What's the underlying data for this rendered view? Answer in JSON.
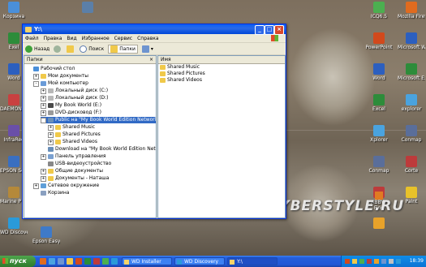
{
  "desktop": {
    "left_icons": [
      {
        "label": "Корзина",
        "color": "#4a8fd9"
      },
      {
        "label": "Exel",
        "color": "#2d8c3a"
      },
      {
        "label": "Word",
        "color": "#2c5fbf"
      },
      {
        "label": "DAEMON Tools L",
        "color": "#c94040"
      },
      {
        "label": "InfraRec",
        "color": "#6a4fa8"
      },
      {
        "label": "EPSON Scan",
        "color": "#3a6fc0"
      },
      {
        "label": "Marine P Empire",
        "color": "#b5893a"
      },
      {
        "label": "WD Discovery",
        "color": "#2a9ad9"
      }
    ],
    "col2_icons": [
      {
        "label": "",
        "color": "#d9d3c2"
      },
      {
        "label": "Epson Easy Photo Print",
        "color": "#3f7ac8"
      }
    ],
    "right_icons": [
      {
        "label": "ICQ6.5",
        "color": "#4caf50"
      },
      {
        "label": "PowerPoint",
        "color": "#d2491c"
      },
      {
        "label": "Word",
        "color": "#2c5fbf"
      },
      {
        "label": "Excel",
        "color": "#2d8c3a"
      },
      {
        "label": "Xplorer",
        "color": "#4aa3df"
      },
      {
        "label": "Conmap",
        "color": "#5a6e9a"
      },
      {
        "label": "",
        "color": "#bd3b3b"
      },
      {
        "label": "",
        "color": "#e8a22a"
      }
    ],
    "right2_icons": [
      {
        "label": "Mozilla Firefox",
        "color": "#e06b1f"
      },
      {
        "label": "Microsoft Word",
        "color": "#2c5fbf"
      },
      {
        "label": "Microsoft Excel",
        "color": "#2d8c3a"
      },
      {
        "label": "explorer",
        "color": "#4aa3df"
      },
      {
        "label": "Conmap",
        "color": "#5a6e9a"
      },
      {
        "label": "Corte",
        "color": "#bd3b3b"
      },
      {
        "label": "Paint",
        "color": "#e8c22a"
      }
    ],
    "watermark": "GYBERSTYLE.RU",
    "midright_labels": [
      "ABBYY",
      "Fine"
    ]
  },
  "window": {
    "title": "Y:\\",
    "menu": [
      "Файл",
      "Правка",
      "Вид",
      "Избранное",
      "Сервис",
      "Справка"
    ],
    "toolbar": {
      "back": "Назад",
      "search": "Поиск",
      "folders": "Папки"
    },
    "left_pane_title": "Папки",
    "tree": [
      {
        "label": "Рабочий стол",
        "depth": 0,
        "exp": "",
        "color": "#4a8fd9"
      },
      {
        "label": "Мои документы",
        "depth": 1,
        "exp": "+",
        "color": "#f0c94a"
      },
      {
        "label": "Мой компьютер",
        "depth": 1,
        "exp": "-",
        "color": "#6a9bd8"
      },
      {
        "label": "Локальный диск (C:)",
        "depth": 2,
        "exp": "+",
        "color": "#b8b8b8"
      },
      {
        "label": "Локальный диск (D:)",
        "depth": 2,
        "exp": "+",
        "color": "#b8b8b8"
      },
      {
        "label": "My Book World (E:)",
        "depth": 2,
        "exp": "+",
        "color": "#4a4a4a"
      },
      {
        "label": "DVD-дисковод (F:)",
        "depth": 2,
        "exp": "+",
        "color": "#9a9a9a"
      },
      {
        "label": "Public на \"My Book World Edition Network Stor",
        "depth": 2,
        "exp": "-",
        "color": "#6a8fb8",
        "selected": true
      },
      {
        "label": "Shared Music",
        "depth": 3,
        "exp": "+",
        "color": "#f0c94a"
      },
      {
        "label": "Shared Pictures",
        "depth": 3,
        "exp": "+",
        "color": "#f0c94a"
      },
      {
        "label": "Shared Videos",
        "depth": 3,
        "exp": "+",
        "color": "#f0c94a"
      },
      {
        "label": "Download на \"My Book World Edition Network",
        "depth": 2,
        "exp": "",
        "color": "#6a8fb8"
      },
      {
        "label": "Панель управления",
        "depth": 2,
        "exp": "+",
        "color": "#7aa0d0"
      },
      {
        "label": "USB-видеоустройство",
        "depth": 2,
        "exp": "",
        "color": "#888888"
      },
      {
        "label": "Общие документы",
        "depth": 2,
        "exp": "+",
        "color": "#f0c94a"
      },
      {
        "label": "Документы - Наташа",
        "depth": 2,
        "exp": "+",
        "color": "#f0c94a"
      },
      {
        "label": "Сетевое окружение",
        "depth": 1,
        "exp": "+",
        "color": "#5f9fd8"
      },
      {
        "label": "Корзина",
        "depth": 1,
        "exp": "",
        "color": "#8aa0c0"
      }
    ],
    "right_pane_col": "Имя",
    "files": [
      "Shared Music",
      "Shared Pictures",
      "Shared Videos"
    ]
  },
  "taskbar": {
    "start": "пуск",
    "tasks": [
      {
        "label": "WD Installer",
        "active": false
      },
      {
        "label": "WD Discovery",
        "active": false
      },
      {
        "label": "Y:\\",
        "active": true
      }
    ],
    "clock": "18:39"
  }
}
